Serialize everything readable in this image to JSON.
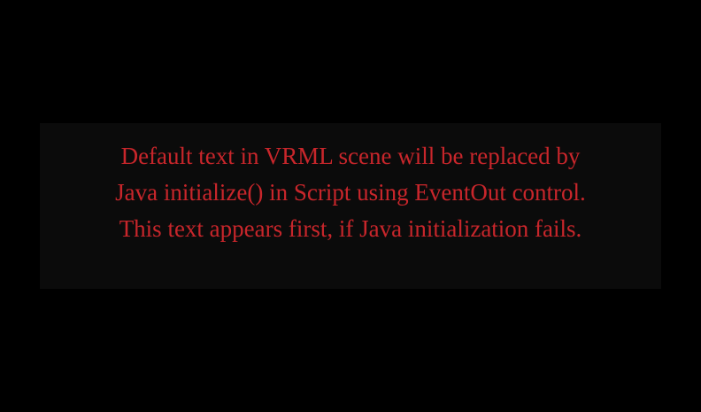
{
  "scene": {
    "background_color": "#000000",
    "panel_color": "#0b0b0b",
    "text_color": "#c8262b",
    "lines": [
      "Default text in VRML scene will be replaced by",
      "Java initialize() in Script using EventOut control.",
      "This text appears first, if Java initialization fails."
    ]
  }
}
